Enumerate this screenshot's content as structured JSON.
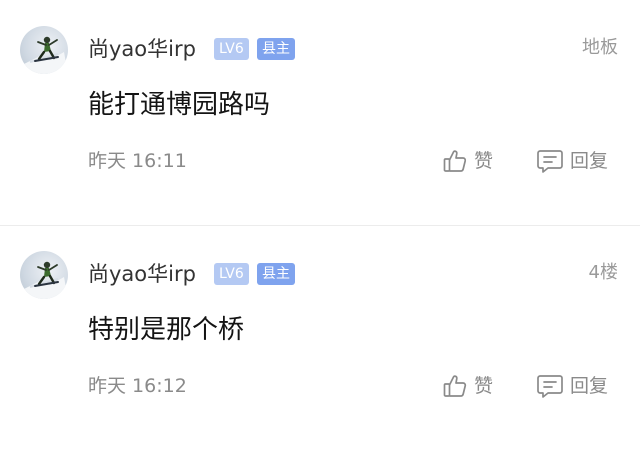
{
  "posts": [
    {
      "username": "尚yao华irp",
      "level_badge": "LV6",
      "role_badge": "县主",
      "floor": "地板",
      "content": "能打通博园路吗",
      "time": "昨天 16:11",
      "like_label": "赞",
      "reply_label": "回复"
    },
    {
      "username": "尚yao华irp",
      "level_badge": "LV6",
      "role_badge": "县主",
      "floor": "4楼",
      "content": "特别是那个桥",
      "time": "昨天 16:12",
      "like_label": "赞",
      "reply_label": "回复"
    }
  ],
  "colors": {
    "level_badge": "#b4c9f3",
    "role_badge": "#7fa3ee",
    "meta_text": "#8a8a8a"
  },
  "icons": {
    "like": "thumbs-up-icon",
    "reply": "comment-icon"
  }
}
